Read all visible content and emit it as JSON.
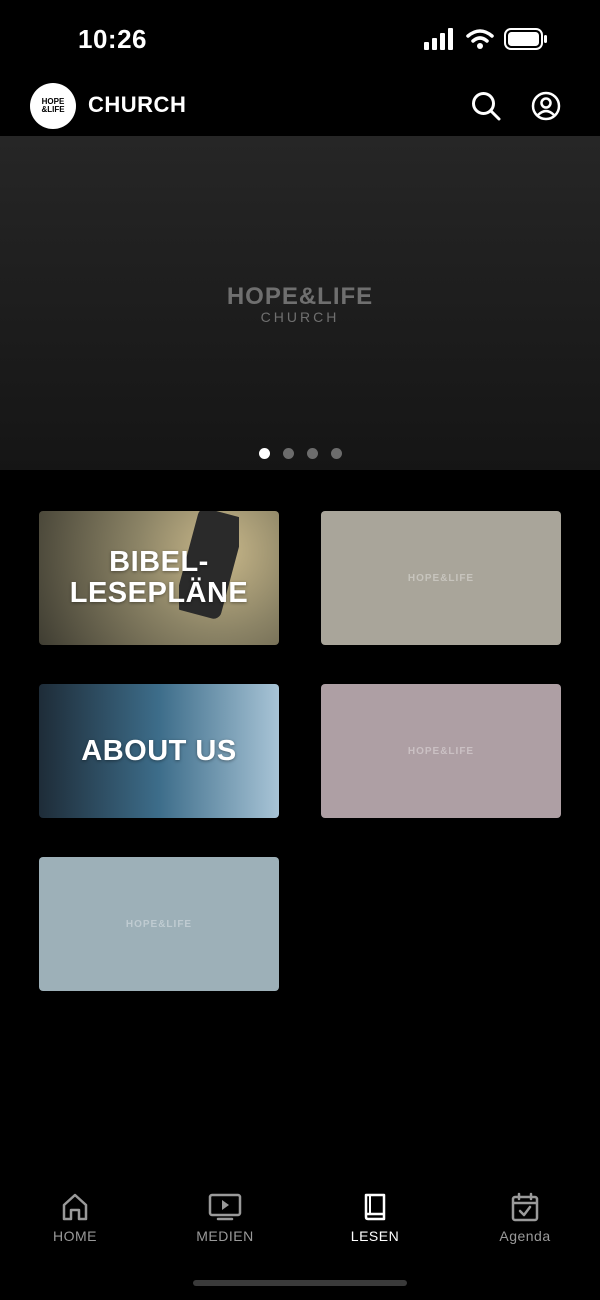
{
  "status_bar": {
    "time": "10:26"
  },
  "header": {
    "logo_line1": "HOPE",
    "logo_line2": "&LIFE",
    "title": "CHURCH",
    "icons": [
      "search-icon",
      "profile-icon"
    ]
  },
  "hero": {
    "logo_main": "HOPE&LIFE",
    "logo_sub": "CHURCH",
    "slides": 4,
    "active_slide": 1
  },
  "tiles": [
    {
      "label": "BIBEL-\nLESEPLÄNE",
      "bg": "#8c8466"
    },
    {
      "label": "",
      "watermark": "HOPE&LIFE",
      "bg": "#a9a59a"
    },
    {
      "label": "ABOUT US",
      "bg": "#3f6378"
    },
    {
      "label": "",
      "watermark": "HOPE&LIFE",
      "bg": "#ae9fa4"
    },
    {
      "label": "",
      "watermark": "HOPE&LIFE",
      "bg": "#9db0b8"
    }
  ],
  "nav": {
    "items": [
      {
        "label": "HOME",
        "icon": "home-icon"
      },
      {
        "label": "MEDIEN",
        "icon": "tv-icon"
      },
      {
        "label": "LESEN",
        "icon": "book-icon"
      },
      {
        "label": "Agenda",
        "icon": "calendar-icon"
      }
    ],
    "active": "LESEN"
  }
}
